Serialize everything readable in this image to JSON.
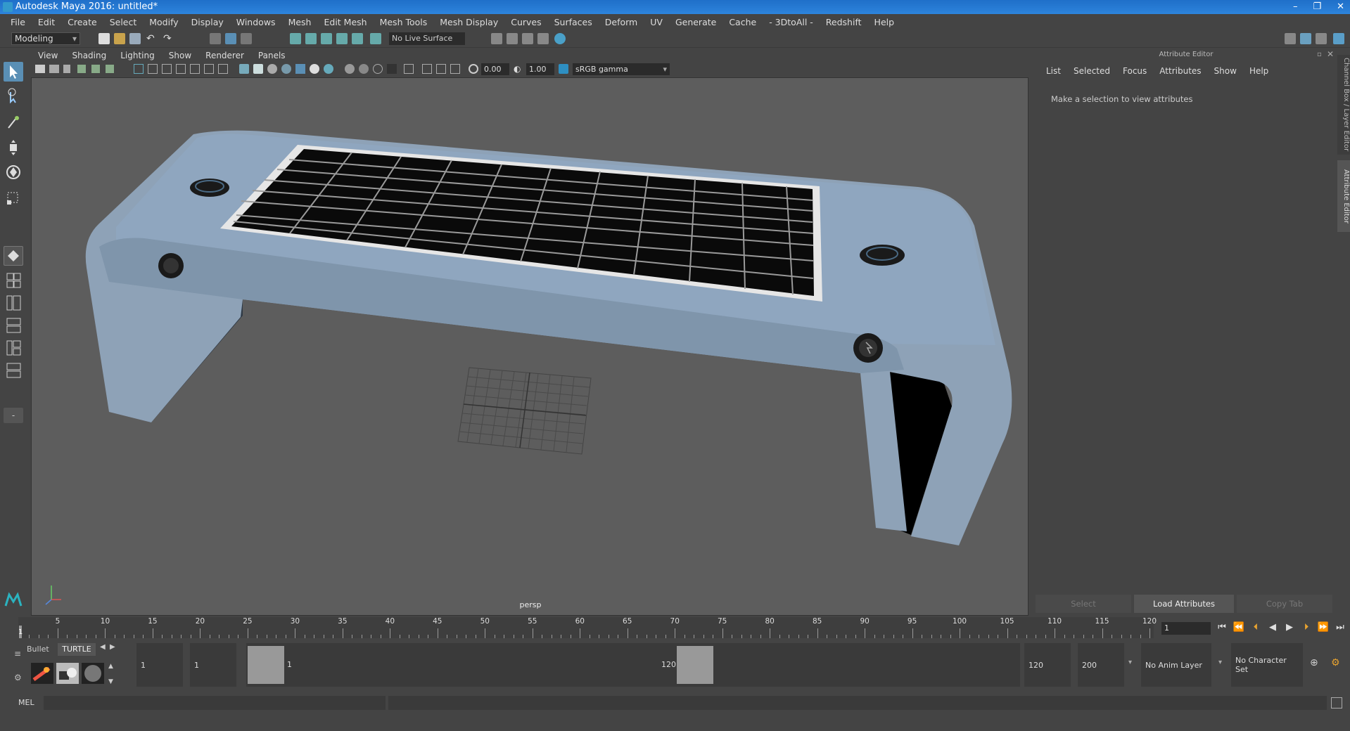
{
  "window": {
    "title": "Autodesk Maya 2016: untitled*",
    "buttons": [
      "–",
      "❐",
      "✕"
    ]
  },
  "menubar": [
    "File",
    "Edit",
    "Create",
    "Select",
    "Modify",
    "Display",
    "Windows",
    "Mesh",
    "Edit Mesh",
    "Mesh Tools",
    "Mesh Display",
    "Curves",
    "Surfaces",
    "Deform",
    "UV",
    "Generate",
    "Cache",
    "- 3DtoAll -",
    "Redshift",
    "Help"
  ],
  "toolbar": {
    "mode": "Modeling",
    "live_surface": "No Live Surface"
  },
  "viewport": {
    "menu": [
      "View",
      "Shading",
      "Lighting",
      "Show",
      "Renderer",
      "Panels"
    ],
    "exposure": "0.00",
    "gamma": "1.00",
    "color_space": "sRGB gamma",
    "camera_label": "persp"
  },
  "attribute_editor": {
    "title": "Attribute Editor",
    "menu": [
      "List",
      "Selected",
      "Focus",
      "Attributes",
      "Show",
      "Help"
    ],
    "message": "Make a selection to view attributes",
    "buttons": {
      "select": "Select",
      "load": "Load Attributes",
      "copy": "Copy Tab"
    },
    "side_tabs": {
      "channel_box": "Channel Box / Layer Editor",
      "attribute_editor": "Attribute Editor"
    }
  },
  "timeline": {
    "ticks": [
      5,
      10,
      15,
      20,
      25,
      30,
      35,
      40,
      45,
      50,
      55,
      60,
      65,
      70,
      75,
      80,
      85,
      90,
      95,
      100,
      105,
      110,
      115,
      120
    ],
    "start_label": "1",
    "current_frame": "1"
  },
  "range": {
    "shelf_tabs": [
      "Bullet",
      "TURTLE"
    ],
    "start_time": "1",
    "playback_start": "1",
    "range_start_label": "1",
    "range_end_label": "120",
    "playback_end": "120",
    "end_time": "200",
    "anim_layer": "No Anim Layer",
    "character_set": "No Character Set"
  },
  "command": {
    "language": "MEL"
  }
}
